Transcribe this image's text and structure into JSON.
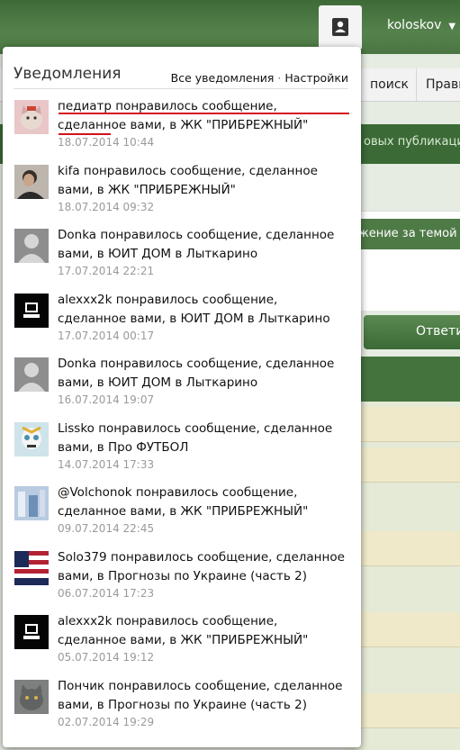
{
  "header": {
    "username": "koloskov"
  },
  "nav": {
    "tabs": [
      "поиск",
      "Прави"
    ]
  },
  "background": {
    "banner": "овых публикаци",
    "track": "жение за темой",
    "reply": "Ответи"
  },
  "panel": {
    "title": "Уведомления",
    "all_link": "Все уведомления",
    "separator": "·",
    "settings_link": "Настройки",
    "items": [
      {
        "text": "педиатр понравилось сообщение, сделанное вами, в ЖК \"ПРИБРЕЖНЫЙ\"",
        "time": "18.07.2014 10:44",
        "avatar": "cat-avatar"
      },
      {
        "text": "kifa понравилось сообщение, сделанное вами, в ЖК \"ПРИБРЕЖНЫЙ\"",
        "time": "18.07.2014 09:32",
        "avatar": "photo-avatar"
      },
      {
        "text": "Donka понравилось сообщение, сделанное вами, в ЮИТ ДОМ в Лыткарино",
        "time": "17.07.2014 22:21",
        "avatar": "default-avatar"
      },
      {
        "text": "alexxx2k понравилось сообщение, сделанное вами, в ЮИТ ДОМ в Лыткарино",
        "time": "17.07.2014 00:17",
        "avatar": "computer-avatar"
      },
      {
        "text": "Donka понравилось сообщение, сделанное вами, в ЮИТ ДОМ в Лыткарино",
        "time": "16.07.2014 19:07",
        "avatar": "default-avatar"
      },
      {
        "text": "Lissko понравилось сообщение, сделанное вами, в Про ФУТБОЛ",
        "time": "14.07.2014 17:33",
        "avatar": "skull-avatar"
      },
      {
        "text": "@Volchonok понравилось сообщение, сделанное вами, в ЖК \"ПРИБРЕЖНЫЙ\"",
        "time": "09.07.2014 22:45",
        "avatar": "blue-photo-avatar"
      },
      {
        "text": "Solo379 понравилось сообщение, сделанное вами, в Прогнозы по Украине (часть 2)",
        "time": "06.07.2014 17:23",
        "avatar": "flag-avatar"
      },
      {
        "text": "alexxx2k понравилось сообщение, сделанное вами, в ЖК \"ПРИБРЕЖНЫЙ\"",
        "time": "05.07.2014 19:12",
        "avatar": "computer-avatar"
      },
      {
        "text": "Пончик понравилось сообщение, сделанное вами, в Прогнозы по Украине (часть 2)",
        "time": "02.07.2014 19:29",
        "avatar": "grey-cat-avatar"
      }
    ]
  },
  "colors": {
    "accent_green": "#4b7643",
    "annotation_red": "#d4111a"
  }
}
